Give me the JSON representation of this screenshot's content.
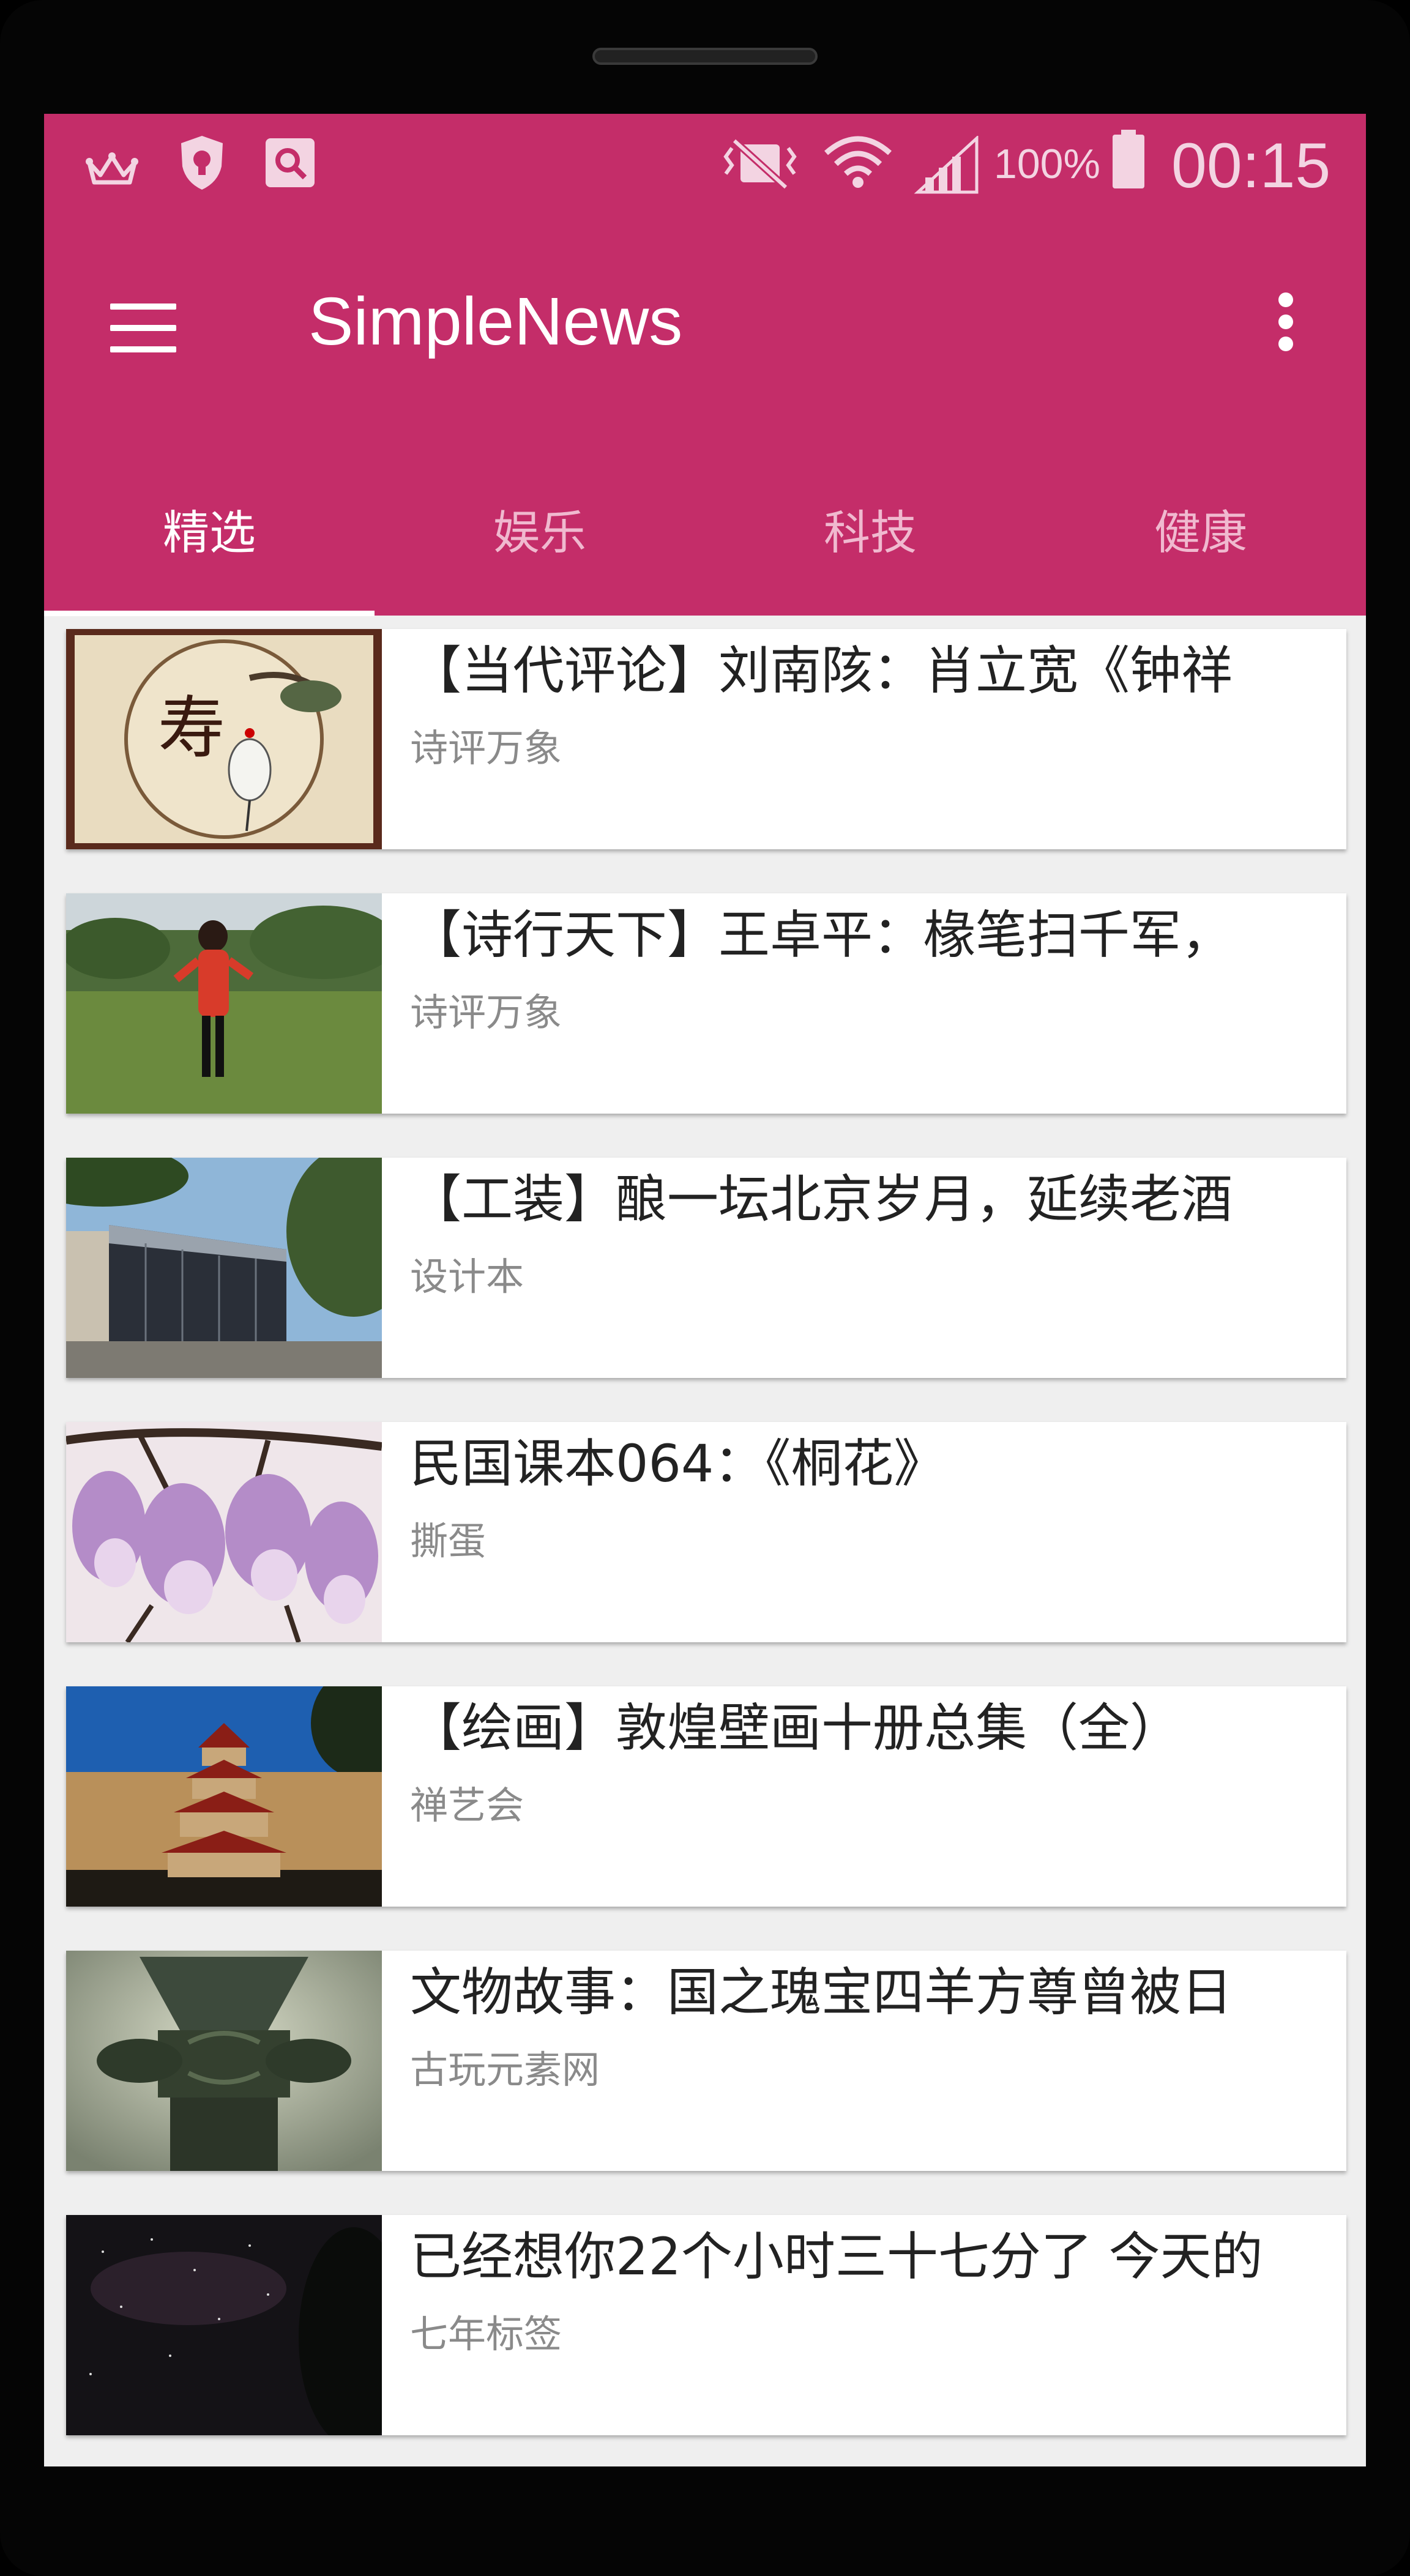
{
  "status_bar": {
    "battery": "100%",
    "time": "00:15",
    "left_icons": [
      "crown-icon",
      "shield-icon",
      "search-badge-icon"
    ],
    "right_icons": [
      "vibrate-icon",
      "wifi-icon",
      "signal-icon",
      "battery-icon"
    ]
  },
  "toolbar": {
    "title": "SimpleNews",
    "menu_icon": "hamburger-menu-icon",
    "overflow_icon": "more-vert-icon"
  },
  "tabs": [
    {
      "label": "精选",
      "active": true
    },
    {
      "label": "娱乐",
      "active": false
    },
    {
      "label": "科技",
      "active": false
    },
    {
      "label": "健康",
      "active": false
    }
  ],
  "articles": [
    {
      "title": "【当代评论】刘南陔：肖立宽《钟祥",
      "source": "诗评万象",
      "thumb": "crane-painting-thumbnail"
    },
    {
      "title": "【诗行天下】王卓平：椽笔扫千军，",
      "source": "诗评万象",
      "thumb": "woman-in-park-thumbnail"
    },
    {
      "title": "【工装】酿一坛北京岁月，延续老酒",
      "source": "设计本",
      "thumb": "glass-building-thumbnail"
    },
    {
      "title": "民国课本064：《桐花》",
      "source": "撕蛋",
      "thumb": "paulownia-flowers-thumbnail"
    },
    {
      "title": "【绘画】敦煌壁画十册总集（全）",
      "source": "禅艺会",
      "thumb": "dunhuang-pagoda-thumbnail"
    },
    {
      "title": "文物故事：国之瑰宝四羊方尊曾被日",
      "source": "古玩元素网",
      "thumb": "bronze-vessel-thumbnail"
    },
    {
      "title": "已经想你22个小时三十七分了 今天的",
      "source": "七年标签",
      "thumb": "night-sky-thumbnail"
    }
  ],
  "colors": {
    "primary": "#c42d69",
    "background": "#efefef",
    "title_text": "#222222",
    "source_text": "#8a8a8a"
  }
}
